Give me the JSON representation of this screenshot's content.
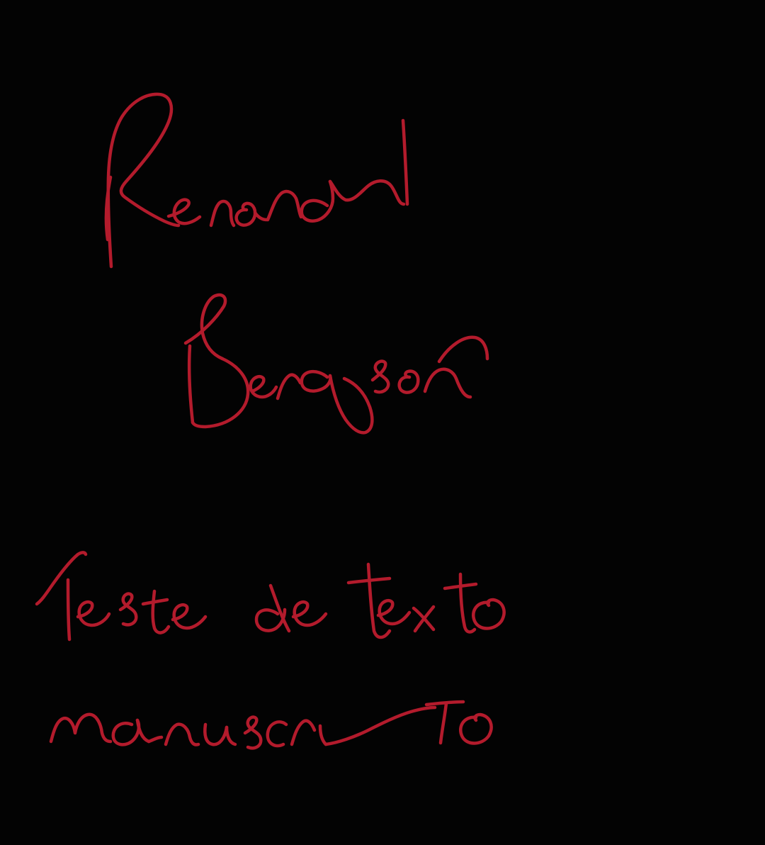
{
  "colors": {
    "background": "#030303",
    "ink": "#b31b2c"
  },
  "handwriting": {
    "line1": "Renard",
    "line2": "Bergson",
    "line3": "Teste de texto",
    "line4": "manuscrito"
  }
}
